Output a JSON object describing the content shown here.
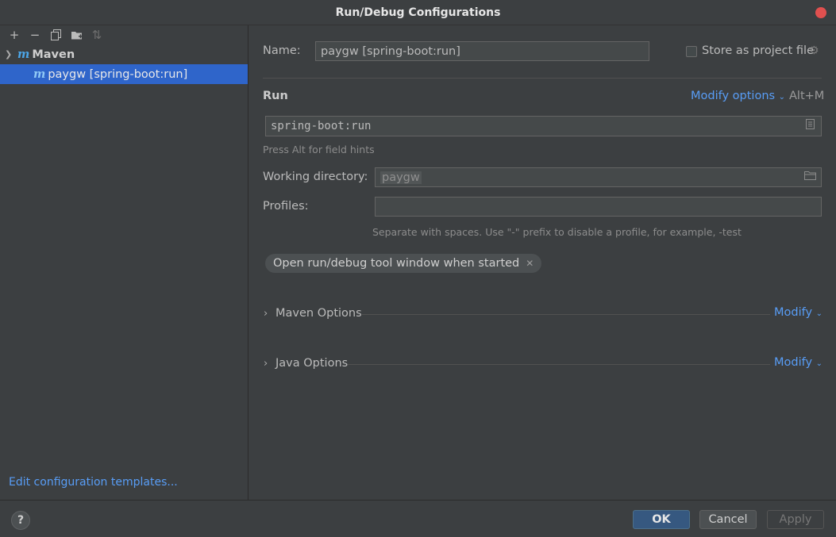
{
  "window": {
    "title": "Run/Debug Configurations"
  },
  "sidebar": {
    "toolbar": [
      {
        "name": "add-icon",
        "glyph": "+"
      },
      {
        "name": "remove-icon",
        "glyph": "−"
      },
      {
        "name": "copy-icon",
        "glyph": "⧉"
      },
      {
        "name": "folder-add-icon",
        "glyph": "▰"
      },
      {
        "name": "sort-icon",
        "glyph": "⇅"
      }
    ],
    "group_label": "Maven",
    "item_label": "paygw [spring-boot:run]",
    "edit_templates": "Edit configuration templates..."
  },
  "form": {
    "name_label": "Name:",
    "name_value": "paygw [spring-boot:run]",
    "store_label": "Store as project file",
    "run_title": "Run",
    "modify_options": "Modify options",
    "modify_shortcut": "Alt+M",
    "command_value": "spring-boot:run",
    "field_hint": "Press Alt for field hints",
    "workdir_label": "Working directory:",
    "workdir_value": "paygw",
    "profiles_label": "Profiles:",
    "profiles_value": "",
    "profiles_hint": "Separate with spaces. Use \"-\" prefix to disable a profile, for example, -test",
    "chip_label": "Open run/debug tool window when started",
    "maven_options": "Maven Options",
    "java_options": "Java Options",
    "modify": "Modify"
  },
  "footer": {
    "help": "?",
    "ok": "OK",
    "cancel": "Cancel",
    "apply": "Apply"
  },
  "colors": {
    "accent": "#589df6",
    "selection": "#2f65ca",
    "background": "#3c3f41"
  }
}
